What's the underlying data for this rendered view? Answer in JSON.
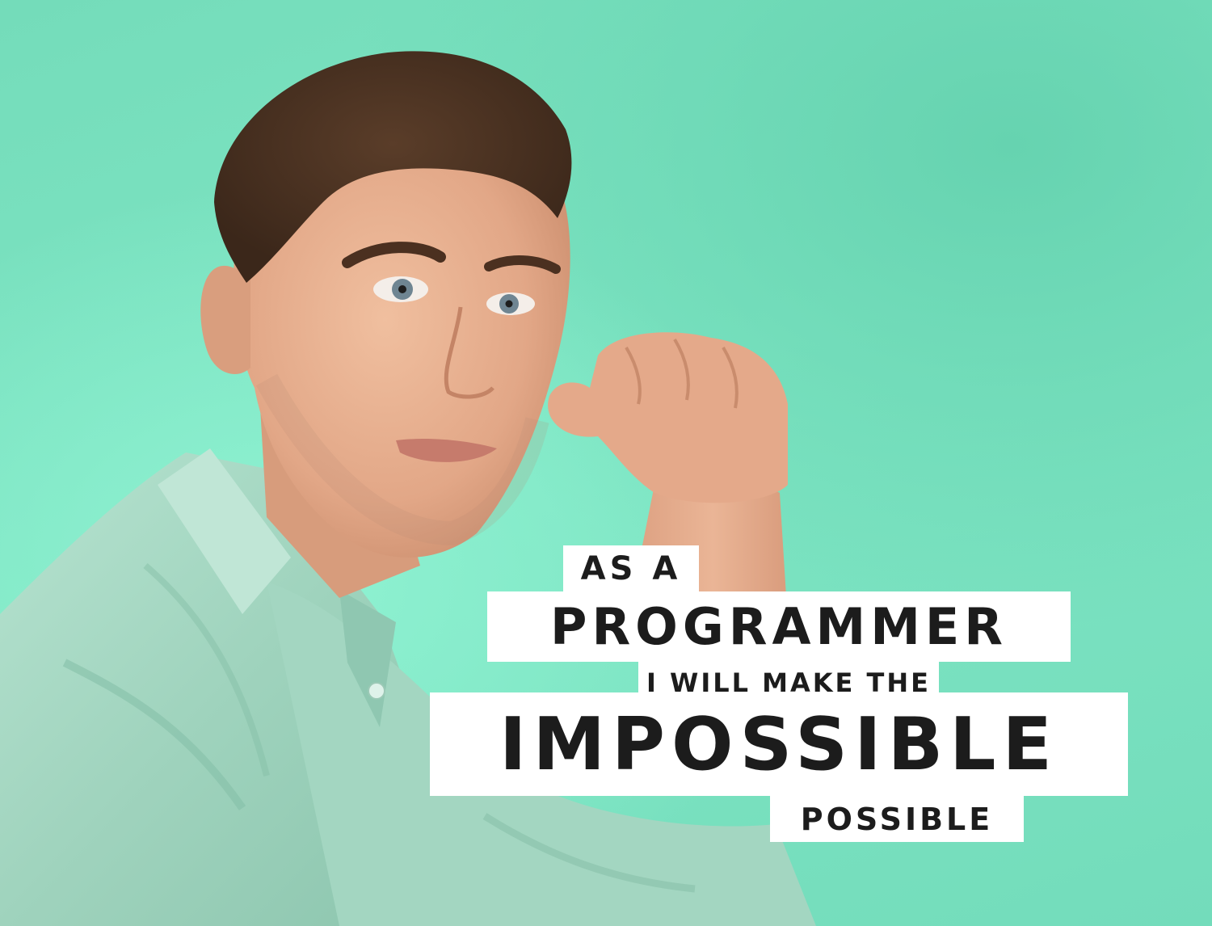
{
  "scene": {
    "description_colors": {
      "background": "#74dcba",
      "shirt": "#a6d8c4",
      "skin": "#e9b293",
      "hair": "#4a3222",
      "caption_bg": "#ffffff",
      "caption_text": "#1c1c1c"
    }
  },
  "caption": {
    "line1": "AS A",
    "line2": "PROGRAMMER",
    "line3": "I WILL MAKE THE",
    "line4": "IMPOSSIBLE",
    "line5": "POSSIBLE"
  }
}
